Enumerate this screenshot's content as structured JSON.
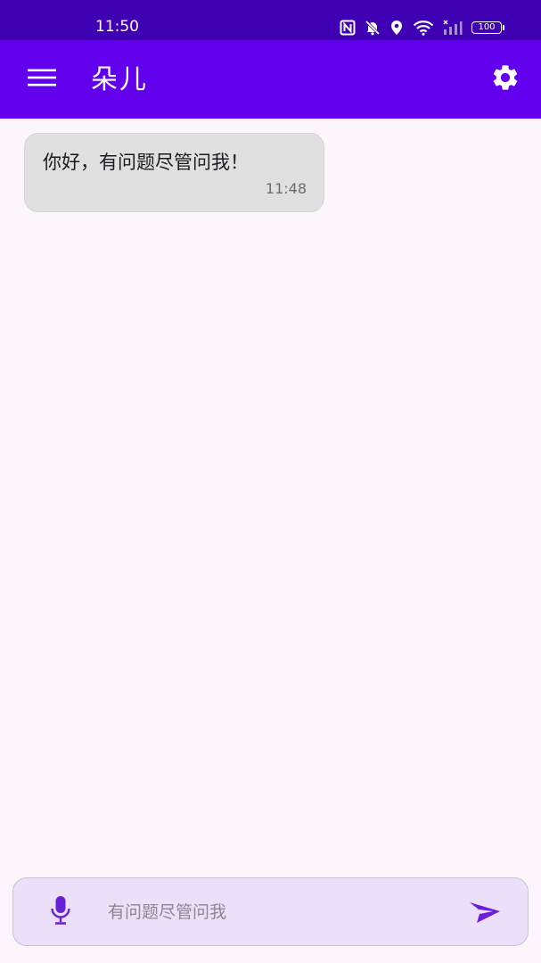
{
  "status_bar": {
    "time": "11:50",
    "battery": "100",
    "icons": [
      "nfc-icon",
      "bell-off-icon",
      "location-icon",
      "wifi-icon",
      "signal-icon",
      "battery-icon"
    ]
  },
  "app_bar": {
    "title": "朵儿",
    "menu_icon": "hamburger-menu-icon",
    "settings_icon": "gear-icon"
  },
  "messages": [
    {
      "text": "你好，有问题尽管问我！",
      "time": "11:48"
    }
  ],
  "input_bar": {
    "placeholder": "有问题尽管问我",
    "value": "",
    "mic_icon": "microphone-icon",
    "send_icon": "send-icon"
  },
  "colors": {
    "status_bar": "#3f00b3",
    "app_bar": "#6200ee",
    "background": "#fcf6fc",
    "bubble": "#e0e0e0",
    "input_bar": "#ecdffa",
    "accent": "#6a1fd8"
  }
}
